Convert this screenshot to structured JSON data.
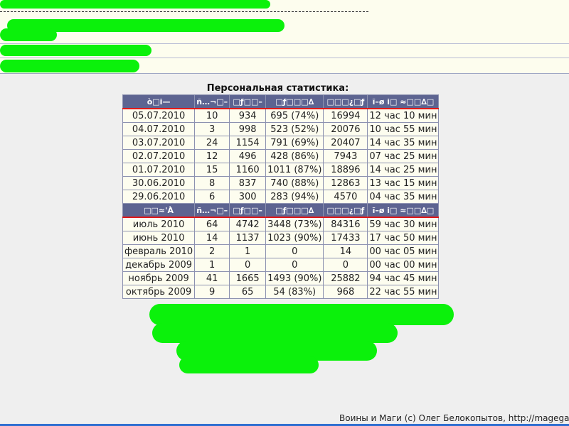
{
  "stats": {
    "title": "Персональная статистика:",
    "daily_header": [
      "ò□i—",
      "ñ…¬□–",
      "□ƒ□□–",
      "□ƒ□□□∆",
      "□□□¿□ƒ",
      "ĩ–ø i□ ≈□□∆□"
    ],
    "daily_rows": [
      [
        "05.07.2010",
        "10",
        "934",
        "695 (74%)",
        "16994",
        "12 час 10 мин"
      ],
      [
        "04.07.2010",
        "3",
        "998",
        "523 (52%)",
        "20076",
        "10 час 55 мин"
      ],
      [
        "03.07.2010",
        "24",
        "1154",
        "791 (69%)",
        "20407",
        "14 час 35 мин"
      ],
      [
        "02.07.2010",
        "12",
        "496",
        "428 (86%)",
        "7943",
        "07 час 25 мин"
      ],
      [
        "01.07.2010",
        "15",
        "1160",
        "1011 (87%)",
        "18896",
        "14 час 25 мин"
      ],
      [
        "30.06.2010",
        "8",
        "837",
        "740 (88%)",
        "12863",
        "13 час 15 мин"
      ],
      [
        "29.06.2010",
        "6",
        "300",
        "283 (94%)",
        "4570",
        "04 час 35 мин"
      ]
    ],
    "monthly_header": [
      "□□≈'À",
      "ñ…¬□–",
      "□ƒ□□–",
      "□ƒ□□□∆",
      "□□□¿□ƒ",
      "ĩ–ø i□ ≈□□∆□"
    ],
    "monthly_rows": [
      [
        "июль 2010",
        "64",
        "4742",
        "3448 (73%)",
        "84316",
        "59 час 30 мин"
      ],
      [
        "июнь 2010",
        "14",
        "1137",
        "1023 (90%)",
        "17433",
        "17 час 50 мин"
      ],
      [
        "февраль 2010",
        "2",
        "1",
        "0",
        "14",
        "00 час 05 мин"
      ],
      [
        "декабрь 2009",
        "1",
        "0",
        "0",
        "0",
        "00 час 00 мин"
      ],
      [
        "ноябрь 2009",
        "41",
        "1665",
        "1493 (90%)",
        "25882",
        "94 час 45 мин"
      ],
      [
        "октябрь 2009",
        "9",
        "65",
        "54 (83%)",
        "968",
        "22 час 55 мин"
      ]
    ]
  },
  "footer": {
    "text": "Воины и Маги (c) Олег Белокопытов, http://magegame"
  },
  "colors": {
    "header_bg": "#5d6491",
    "header_underline": "#e01818",
    "cell_bg": "#fdfdef",
    "redaction": "#0bf10b"
  }
}
